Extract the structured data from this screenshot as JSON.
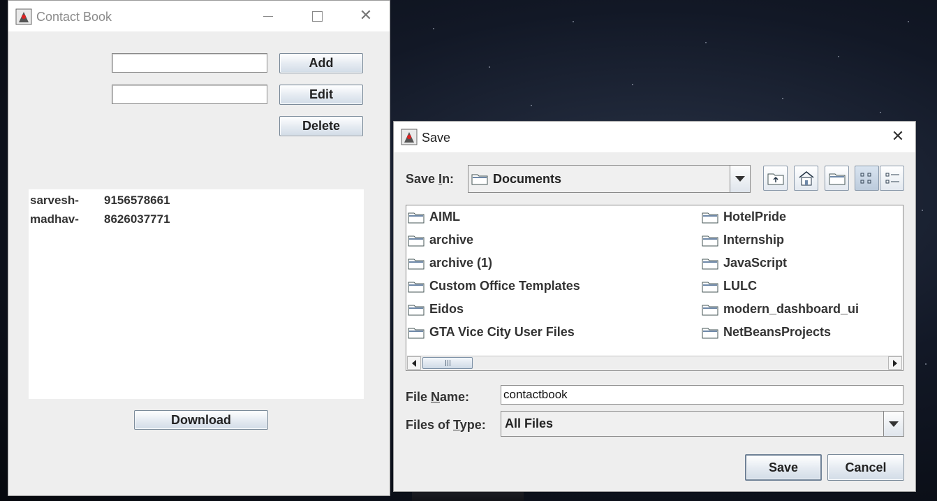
{
  "contact_window": {
    "title": "Contact Book",
    "name_field_value": "",
    "number_field_value": "",
    "add_label": "Add",
    "edit_label": "Edit",
    "delete_label": "Delete",
    "contacts": [
      {
        "name": "sarvesh-",
        "number": "9156578661"
      },
      {
        "name": "madhav-",
        "number": "8626037771"
      }
    ],
    "download_label": "Download",
    "icons": {
      "app": "java-duke-icon",
      "minimize": "minimize-icon",
      "maximize": "maximize-icon",
      "close": "close-icon"
    }
  },
  "save_dialog": {
    "title": "Save",
    "save_in_label_pre": "Save ",
    "save_in_label_mnemonic": "I",
    "save_in_label_post": "n:",
    "save_in_value": "Documents",
    "toolbar_icons": [
      "up-one-level-icon",
      "home-icon",
      "new-folder-icon",
      "list-view-icon",
      "details-view-icon"
    ],
    "files_left": [
      "AIML",
      "archive",
      "archive (1)",
      "Custom Office Templates",
      "Eidos",
      "GTA Vice City User Files"
    ],
    "files_right": [
      "HotelPride",
      "Internship",
      "JavaScript",
      "LULC",
      "modern_dashboard_ui",
      "NetBeansProjects"
    ],
    "file_name_label_pre": "File ",
    "file_name_label_mnemonic": "N",
    "file_name_label_post": "ame:",
    "file_name_value": "contactbook",
    "files_of_type_label_pre": "Files of ",
    "files_of_type_label_mnemonic": "T",
    "files_of_type_label_post": "ype:",
    "files_of_type_value": "All Files",
    "save_label": "Save",
    "cancel_label": "Cancel"
  }
}
